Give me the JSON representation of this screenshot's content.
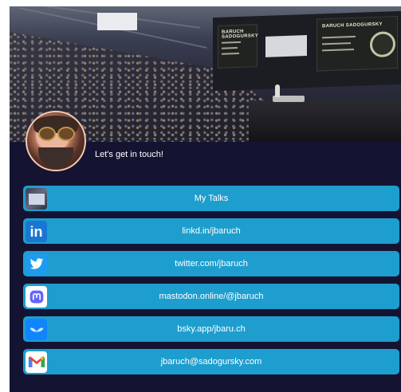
{
  "profile": {
    "tagline": "Let's get in touch!"
  },
  "hero": {
    "screen_title_left": "BARUCH SADOGURSKY",
    "screen_title_right": "BARUCH SADOGURSKY"
  },
  "links": [
    {
      "label": "My Talks",
      "icon": "talks-thumbnail-icon"
    },
    {
      "label": "linkd.in/jbaruch",
      "icon": "linkedin-icon"
    },
    {
      "label": "twitter.com/jbaruch",
      "icon": "twitter-icon"
    },
    {
      "label": "mastodon.online/@jbaruch",
      "icon": "mastodon-icon"
    },
    {
      "label": "bsky.app/jbaru.ch",
      "icon": "bluesky-icon"
    },
    {
      "label": "jbaruch@sadogursky.com",
      "icon": "gmail-icon"
    }
  ],
  "colors": {
    "page_background": "#141432",
    "button_background": "#1e9ece",
    "text": "#ffffff"
  }
}
